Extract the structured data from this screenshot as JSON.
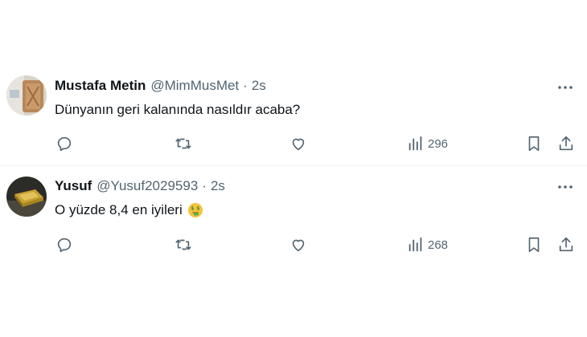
{
  "colors": {
    "text_primary": "#0f1419",
    "text_secondary": "#536471",
    "divider": "#eff3f4"
  },
  "tweets": [
    {
      "name": "Mustafa Metin",
      "handle": "@MimMusMet",
      "dot": "·",
      "time": "2s",
      "text": "Dünyanın geri kalanında nasıldır acaba?",
      "views": "296",
      "avatar_icon": "wooden-object-avatar",
      "more_icon": "more-dots-icon"
    },
    {
      "name": "Yusuf",
      "handle": "@Yusuf2029593",
      "dot": "·",
      "time": "2s",
      "text": "O yüzde 8,4 en iyileri",
      "emoji": "money-mouth-face-emoji",
      "views": "268",
      "avatar_icon": "gold-bar-avatar",
      "more_icon": "more-dots-icon"
    }
  ],
  "action_icons": [
    "reply-icon",
    "repost-icon",
    "like-icon",
    "views-icon",
    "bookmark-icon",
    "share-icon"
  ]
}
